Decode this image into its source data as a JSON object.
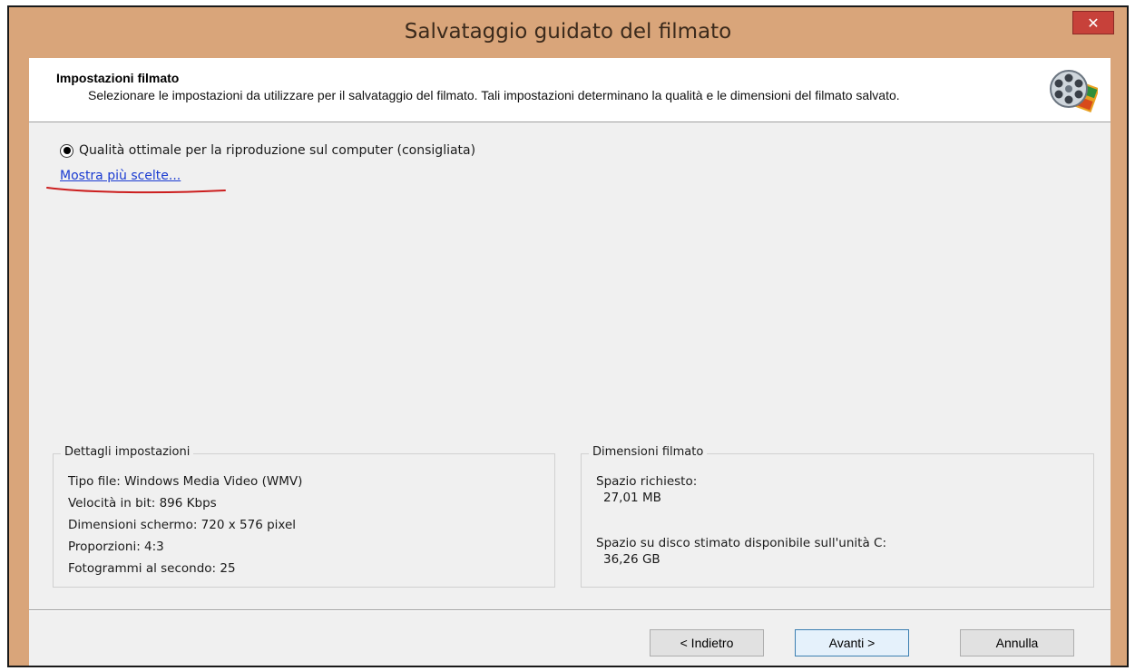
{
  "window": {
    "title": "Salvataggio guidato del filmato",
    "close_label": "✕"
  },
  "header": {
    "title": "Impostazioni filmato",
    "description": "Selezionare le impostazioni da utilizzare per il salvataggio del filmato. Tali impostazioni determinano la qualità e le dimensioni del filmato salvato.",
    "icon": "film-reel-icon"
  },
  "options": {
    "selected_label": "Qualità ottimale per la riproduzione sul computer (consigliata)",
    "more_choices_link": "Mostra più scelte..."
  },
  "details": {
    "legend": "Dettagli impostazioni",
    "lines": [
      "Tipo file: Windows Media Video (WMV)",
      "Velocità in bit: 896 Kbps",
      "Dimensioni schermo: 720 x 576 pixel",
      "Proporzioni: 4:3",
      "Fotogrammi al secondo: 25"
    ]
  },
  "size": {
    "legend": "Dimensioni filmato",
    "required_label": "Spazio richiesto:",
    "required_value": "27,01 MB",
    "available_label": "Spazio su disco stimato disponibile sull'unità C:",
    "available_value": "36,26 GB"
  },
  "buttons": {
    "back": "< Indietro",
    "next": "Avanti >",
    "cancel": "Annulla"
  },
  "colors": {
    "title_bar": "#d9a57a",
    "close_button": "#c7413a",
    "link": "#1a3bd1",
    "annotation": "#cc1f1f"
  }
}
